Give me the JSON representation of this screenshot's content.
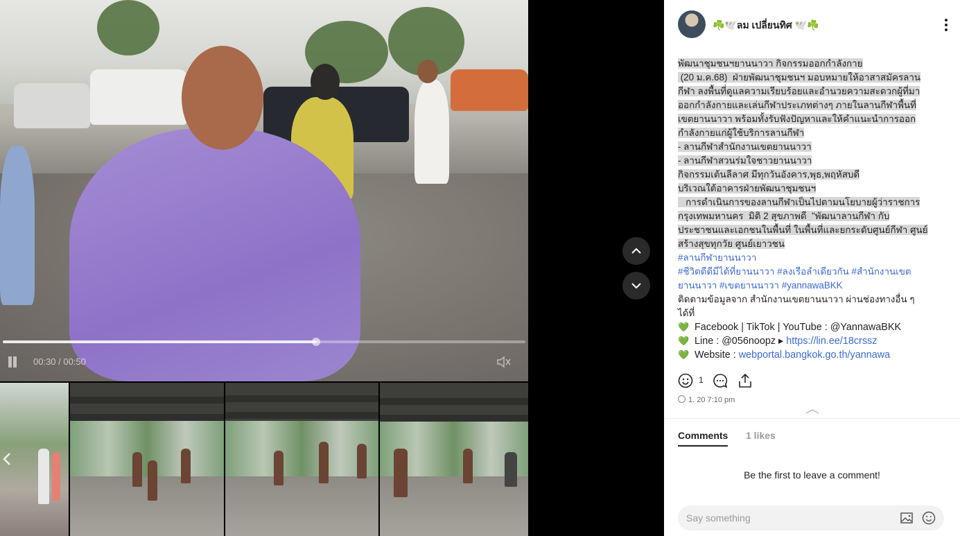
{
  "video": {
    "time_label": "00:30 / 00:50",
    "progress": 0.6
  },
  "author": {
    "name": "☘️🕊️ลม เปลี่ยนทิศ 🕊️☘️"
  },
  "post": {
    "lines": [
      "พัฒนาชุมชนฯยานนาวา กิจกรรมออกกำลังกาย",
      " (20 ม.ค.68)  ฝ่ายพัฒนาชุมชนฯ มอบหมายให้อาสาสมัครลาน",
      "กีฬา ลงพื้นที่ดูแลความเรียบร้อยและอำนวยความสะดวกผู้ที่มา",
      "ออกกำลังกายและเล่นกีฬาประเภทต่างๆ ภายในลานกีฬาพื้นที่",
      "เขตยานนาวา พร้อมทั้งรับฟังปัญหาและให้คำแนะนำการออก",
      "กำลังกายแก่ผู้ใช้บริการลานกีฬา",
      "- ลานกีฬาสำนักงานเขตยานนาวา",
      "- ลานกีฬาสวนร่มใจชาวยานนาวา",
      "กิจกรรมเต้นลีลาศ มีทุกวันอังคาร,พุธ,พฤหัสบดี",
      "บริเวณใต้อาคารฝ่ายพัฒนาชุมชนฯ",
      "   การดำเนินการของลานกีฬาเป็นไปตามนโยบายผู้ว่าราชการ",
      "กรุงเทพมหานคร  มิติ 2 สุขภาพดี  \"พัฒนาลานกีฬา กับ",
      "ประชาชนและเอกชนในพื้นที่ ในพื้นที่และยกระดับศูนย์กีฬา ศูนย์",
      "สร้างสุขทุกวัย ศูนย์เยาวชน"
    ],
    "tags_line1": "#ลานกีฬายานนาวา",
    "tags_line2": "#ชีวิตดีดีมีได้ที่ยานนาวา #ลงเรือลำเดียวกัน #สำนักงานเขต",
    "tags_line3": "ยานนาวา #เขตยานนาวา #yannawaBKK",
    "follow_line1": "ติดตามข้อมูลจาก สำนักงานเขตยานนาวา ผ่านช่องทางอื่น ๆ",
    "follow_line2": "ได้ที่",
    "social": "Facebook | TikTok | YouTube : @YannawaBKK",
    "line_label": "Line : @056noopz ▸ ",
    "line_link": "https://lin.ee/18crssz",
    "website_label": "Website : ",
    "website_link": "webportal.bangkok.go.th/yannawa",
    "heart_glyph": "💚"
  },
  "actions": {
    "like_count": "1"
  },
  "timestamp": "1. 20 7:10 pm",
  "tabs": {
    "comments": "Comments",
    "likes": "1 likes"
  },
  "empty_comments": "Be the first to leave a comment!",
  "comment_input": {
    "placeholder": "Say something"
  },
  "colors": {
    "hashtag": "#3c6ad6",
    "heart": "#2bc06b",
    "highlight": "#d7d7d7"
  }
}
